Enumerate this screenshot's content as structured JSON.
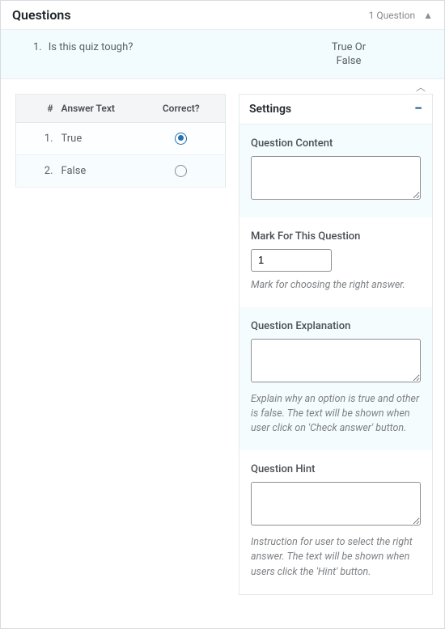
{
  "header": {
    "title": "Questions",
    "count_label": "1 Question"
  },
  "question": {
    "number": "1.",
    "text": "Is this quiz tough?",
    "type_line1": "True Or",
    "type_line2": "False"
  },
  "answers": {
    "columns": {
      "hash": "#",
      "text": "Answer Text",
      "correct": "Correct?"
    },
    "rows": [
      {
        "num": "1.",
        "text": "True",
        "correct": true
      },
      {
        "num": "2.",
        "text": "False",
        "correct": false
      }
    ]
  },
  "settings": {
    "title": "Settings",
    "content": {
      "label": "Question Content",
      "value": ""
    },
    "mark": {
      "label": "Mark For This Question",
      "value": "1",
      "helper": "Mark for choosing the right answer."
    },
    "explanation": {
      "label": "Question Explanation",
      "value": "",
      "helper": "Explain why an option is true and other is false. The text will be shown when user click on 'Check answer' button."
    },
    "hint": {
      "label": "Question Hint",
      "value": "",
      "helper": "Instruction for user to select the right answer. The text will be shown when users click the 'Hint' button."
    }
  }
}
